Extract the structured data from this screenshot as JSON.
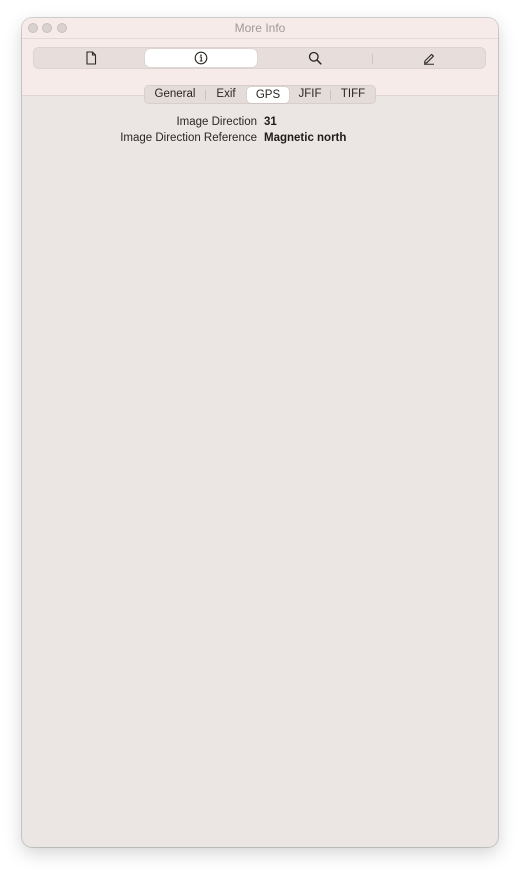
{
  "window": {
    "title": "More Info"
  },
  "toolbar": {
    "items": [
      {
        "icon": "document-icon",
        "active": false
      },
      {
        "icon": "info-icon",
        "active": true
      },
      {
        "icon": "magnifier-icon",
        "active": false
      },
      {
        "icon": "pencil-icon",
        "active": false
      }
    ]
  },
  "subtabs": {
    "items": [
      "General",
      "Exif",
      "GPS",
      "JFIF",
      "TIFF"
    ],
    "selected": "GPS"
  },
  "gps": {
    "rows": [
      {
        "label": "Image Direction",
        "value": "31"
      },
      {
        "label": "Image Direction Reference",
        "value": "Magnetic north"
      }
    ]
  },
  "colors": {
    "window_bg": "#ebe6e3",
    "titlebar_bg": "#f6ebe8",
    "active_segment": "#ffffff"
  }
}
